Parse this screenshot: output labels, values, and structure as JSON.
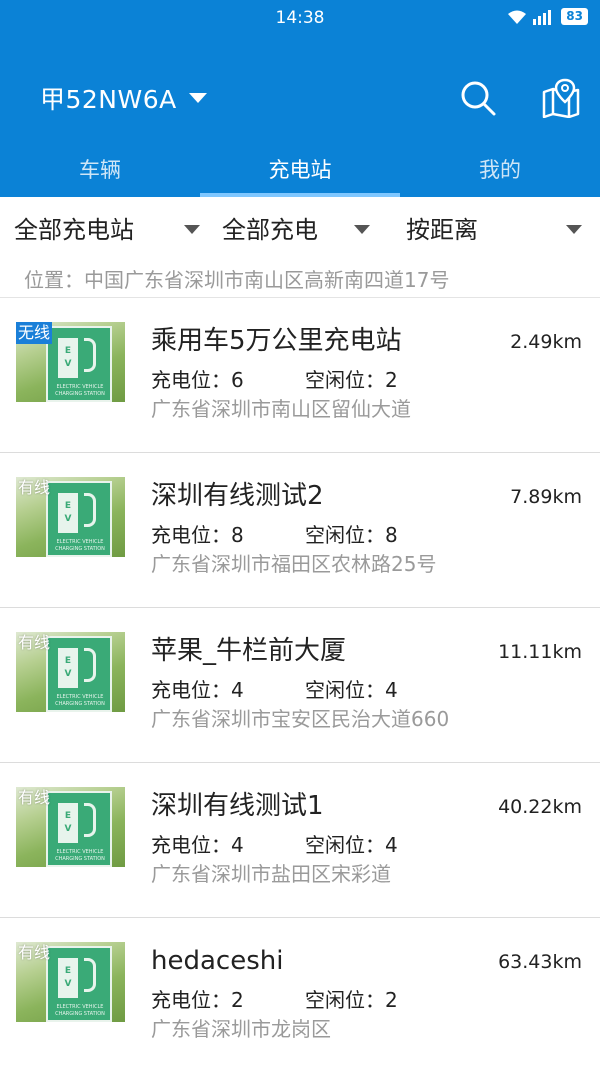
{
  "status_bar": {
    "time": "14:38",
    "battery": "83"
  },
  "header": {
    "plate": "甲52NW6A"
  },
  "tabs": [
    {
      "label": "车辆",
      "active": false
    },
    {
      "label": "充电站",
      "active": true
    },
    {
      "label": "我的",
      "active": false
    }
  ],
  "filters": {
    "station_type": "全部充电站",
    "charge_type": "全部充电",
    "sort": "按距离"
  },
  "location": "位置：中国广东省深圳市南山区高新南四道17号",
  "stations": [
    {
      "tag": "无线",
      "name": "乘用车5万公里充电站",
      "distance": "2.49km",
      "total_label": "充电位：6",
      "free_label": "空闲位：2",
      "address": "广东省深圳市南山区留仙大道"
    },
    {
      "tag": "有线",
      "name": "深圳有线测试2",
      "distance": "7.89km",
      "total_label": "充电位：8",
      "free_label": "空闲位：8",
      "address": "广东省深圳市福田区农林路25号"
    },
    {
      "tag": "有线",
      "name": "苹果_牛栏前大厦",
      "distance": "11.11km",
      "total_label": "充电位：4",
      "free_label": "空闲位：4",
      "address": "广东省深圳市宝安区民治大道660"
    },
    {
      "tag": "有线",
      "name": "深圳有线测试1",
      "distance": "40.22km",
      "total_label": "充电位：4",
      "free_label": "空闲位：4",
      "address": "广东省深圳市盐田区宋彩道"
    },
    {
      "tag": "有线",
      "name": "hedaceshi",
      "distance": "63.43km",
      "total_label": "充电位：2",
      "free_label": "空闲位：2",
      "address": "广东省深圳市龙岗区"
    }
  ],
  "icons": {
    "search": "search-icon",
    "map": "map-pin-icon",
    "dropdown": "caret-down-icon"
  },
  "colors": {
    "primary": "#0b82d6",
    "tab_indicator": "#7fc7ff",
    "secondary_text": "#9a9a9a",
    "wireless_tag": "#1a7fd8"
  }
}
